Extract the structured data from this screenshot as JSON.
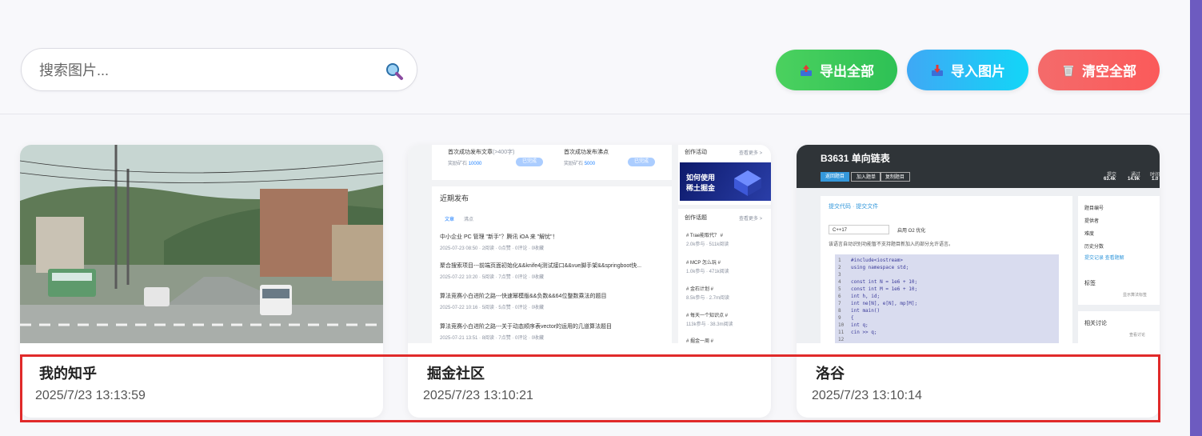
{
  "search": {
    "placeholder": "搜索图片..."
  },
  "toolbar": {
    "export_label": "导出全部",
    "import_label": "导入图片",
    "clear_label": "清空全部"
  },
  "cards": [
    {
      "title": "我的知乎",
      "time": "2025/7/23 13:13:59"
    },
    {
      "title": "掘金社区",
      "time": "2025/7/23 13:10:21"
    },
    {
      "title": "洛谷",
      "time": "2025/7/23 13:10:14"
    }
  ],
  "juejin": {
    "first_post": "首次成功发布文章",
    "first_post_hint": "(>400字)",
    "first_post_reward": "奖励矿石",
    "first_post_amount": "10000",
    "first_pin": "首次成功发布沸点",
    "first_pin_reward": "奖励矿石",
    "first_pin_amount": "5000",
    "claim": "已完成",
    "activity_title": "创作活动",
    "see_more": "查看更多 >",
    "banner_line1": "如何使用",
    "banner_line2": "稀土掘金",
    "recent_title": "近期发布",
    "tab_articles": "文章",
    "tab_pins": "沸点",
    "posts": [
      {
        "title": "中小企业 PC 管理 \"新手\"？腾讯 iOA 来 \"解忧\"！",
        "meta": "2025-07-23 08:50 · 2阅读 · 0点赞 · 0评论 · 0收藏"
      },
      {
        "title": "聚合搜索项目---前端页面初始化&&knife4j测试接口&&vue脚手架&&springboot快...",
        "meta": "2025-07-22 10:20 · 5阅读 · 7点赞 · 0评论 · 0收藏"
      },
      {
        "title": "算法竞赛小白进阶之路---快速幂模版&&负数&&64位整数乘法的题目",
        "meta": "2025-07-22 10:16 · 5阅读 · 5点赞 · 0评论 · 0收藏"
      },
      {
        "title": "算法竞赛小白进阶之路---关于动态顺序表vector的运用的几道算法题目",
        "meta": "2025-07-21 13:51 · 8阅读 · 7点赞 · 0评论 · 0收藏"
      }
    ],
    "topics_title": "创作话题",
    "topics": [
      {
        "name": "# Trae能取代？ #",
        "meta": "2.0k参与 · 511k阅读"
      },
      {
        "name": "# MCP 怎么玩 #",
        "meta": "1.0k参与 · 471k阅读"
      },
      {
        "name": "# 金石计划 #",
        "meta": "8.5k参与 · 2.7m阅读"
      },
      {
        "name": "# 每天一个知识点 #",
        "meta": "113k参与 · 38.3m阅读"
      },
      {
        "name": "# 掘金一周 #",
        "meta": ""
      }
    ]
  },
  "luogu": {
    "problem_title": "B3631 单向链表",
    "actions": [
      "返回题目",
      "加入题单",
      "复制题目"
    ],
    "stats": [
      {
        "label": "提交",
        "value": "63.4k"
      },
      {
        "label": "通过",
        "value": "14.9k"
      },
      {
        "label": "时间",
        "value": "1.0"
      }
    ],
    "breadcrumb": "提交代码 · 提交文件",
    "language": "C++17",
    "o2_label": "启用 O2 优化",
    "notice": "该语言自动识别功能暂不支持题目新加入的部分允许语言。",
    "code_lines": [
      "#include<iostream>",
      "using namespace std;",
      "",
      "const int N = 1e6 + 10;",
      "const int M = 1e6 + 10;",
      "int h, id;",
      "int ne[N], e[N], mp[M];",
      "int main()",
      "{",
      "    int q;",
      "    cin >> q;",
      ""
    ],
    "side_labels": [
      "题目编号",
      "提供者",
      "难度",
      "历史分数"
    ],
    "side_links": "提交记录  查看题解",
    "tags_title": "标签",
    "tags_hint": "显示算法标签",
    "discuss_title": "相关讨论",
    "discuss_hint": "查看讨论"
  },
  "colors": {
    "export_btn": "#3cc95a",
    "import_btn": "#29bff6",
    "clear_btn": "#f76363",
    "highlight_border": "#e02a2a",
    "right_strip": "#6d5bc0"
  }
}
